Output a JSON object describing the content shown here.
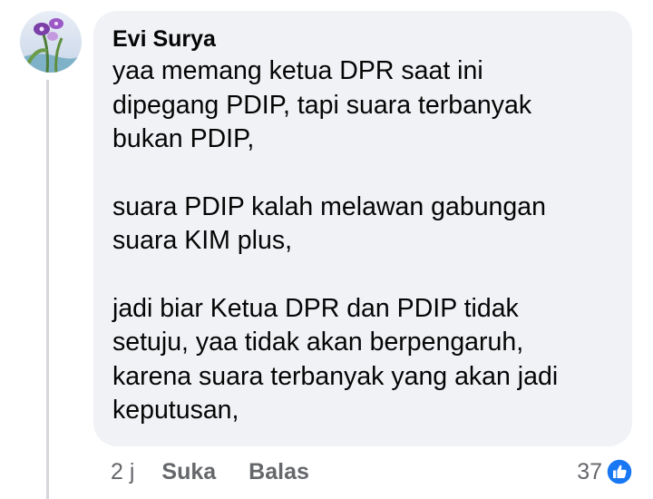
{
  "comment": {
    "author": "Evi Surya",
    "paragraphs": [
      [
        "yaa memang ketua DPR saat ini",
        "dipegang PDIP, tapi suara terbanyak",
        "bukan PDIP,"
      ],
      [
        "suara PDIP kalah melawan gabungan",
        "suara KIM plus,"
      ],
      [
        "jadi biar Ketua DPR dan PDIP tidak",
        "setuju, yaa tidak akan berpengaruh,",
        "karena suara terbanyak yang akan jadi",
        "keputusan,"
      ]
    ],
    "time": "2 j",
    "like_label": "Suka",
    "reply_label": "Balas",
    "reaction_count": "37"
  },
  "icons": {
    "reaction": "like-thumb-icon",
    "avatar": "profile-photo"
  },
  "colors": {
    "bubble": "#f0f2f5",
    "text": "#050505",
    "meta": "#65676b",
    "like_blue": "#1877f2"
  }
}
